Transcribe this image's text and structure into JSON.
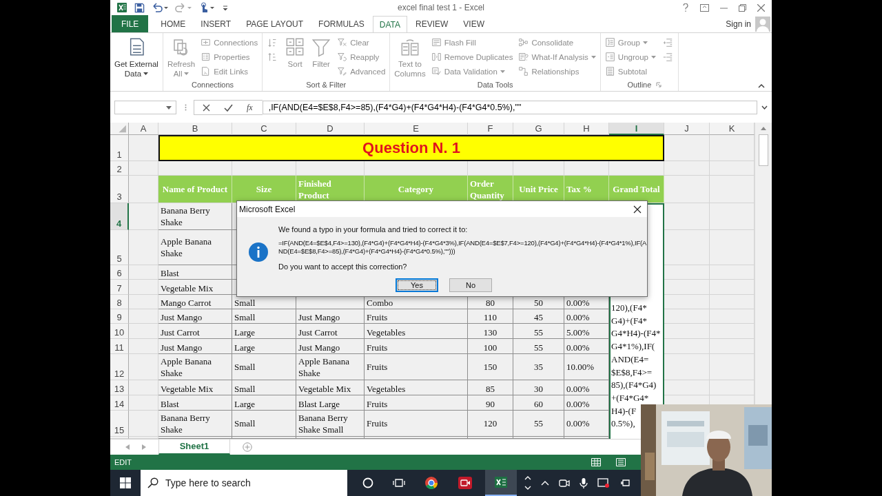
{
  "window": {
    "title": "excel final test 1 - Excel"
  },
  "ribbon_tabs": [
    {
      "label": "FILE",
      "kind": "file",
      "selected": false
    },
    {
      "label": "HOME",
      "kind": "tab",
      "selected": false
    },
    {
      "label": "INSERT",
      "kind": "tab",
      "selected": false
    },
    {
      "label": "PAGE LAYOUT",
      "kind": "tab",
      "selected": false
    },
    {
      "label": "FORMULAS",
      "kind": "tab",
      "selected": false
    },
    {
      "label": "DATA",
      "kind": "tab",
      "selected": true
    },
    {
      "label": "REVIEW",
      "kind": "tab",
      "selected": false
    },
    {
      "label": "VIEW",
      "kind": "tab",
      "selected": false
    }
  ],
  "account": {
    "label": "Sign in"
  },
  "ribbon_groups": [
    {
      "items": [
        {
          "lines": [
            "Get External",
            "Data"
          ],
          "kind": "large",
          "dropdown": true,
          "disabled": false
        }
      ]
    },
    {
      "label": "Connections",
      "items": [
        {
          "lines": [
            "Refresh",
            "All"
          ],
          "kind": "large",
          "dropdown": true,
          "disabled": true
        },
        {
          "lines": [
            "Connections"
          ],
          "kind": "small",
          "disabled": true
        },
        {
          "lines": [
            "Properties"
          ],
          "kind": "small",
          "disabled": true
        },
        {
          "lines": [
            "Edit Links"
          ],
          "kind": "small",
          "disabled": true
        }
      ]
    },
    {
      "label": "Sort & Filter",
      "items": [
        {
          "kind": "small",
          "disabled": true
        },
        {
          "kind": "small",
          "disabled": true
        },
        {
          "lines": [
            "Sort"
          ],
          "kind": "large",
          "disabled": true
        },
        {
          "lines": [
            "Filter"
          ],
          "kind": "large",
          "disabled": true
        },
        {
          "lines": [
            "Clear"
          ],
          "kind": "small",
          "disabled": true
        },
        {
          "lines": [
            "Reapply"
          ],
          "kind": "small",
          "disabled": true
        },
        {
          "lines": [
            "Advanced"
          ],
          "kind": "small",
          "disabled": true
        }
      ]
    },
    {
      "label": "Data Tools",
      "items": [
        {
          "lines": [
            "Text to",
            "Columns"
          ],
          "kind": "large",
          "disabled": true
        },
        {
          "lines": [
            "Flash Fill"
          ],
          "kind": "small",
          "disabled": true
        },
        {
          "lines": [
            "Remove Duplicates"
          ],
          "kind": "small",
          "disabled": true
        },
        {
          "lines": [
            "Data Validation"
          ],
          "kind": "small",
          "dropdown": true,
          "disabled": true
        },
        {
          "lines": [
            "Consolidate"
          ],
          "kind": "small",
          "disabled": true
        },
        {
          "lines": [
            "What-If Analysis"
          ],
          "kind": "small",
          "dropdown": true,
          "disabled": true
        },
        {
          "lines": [
            "Relationships"
          ],
          "kind": "small",
          "disabled": true
        }
      ]
    },
    {
      "label": "Outline",
      "items": [
        {
          "lines": [
            "Group"
          ],
          "kind": "small",
          "dropdown": true,
          "disabled": true
        },
        {
          "lines": [
            "Ungroup"
          ],
          "kind": "small",
          "dropdown": true,
          "disabled": true
        },
        {
          "lines": [
            "Subtotal"
          ],
          "kind": "small",
          "disabled": true
        },
        {
          "kind": "small",
          "disabled": true
        },
        {
          "kind": "small",
          "disabled": true
        }
      ]
    }
  ],
  "formula_bar": {
    "function_label": "fx",
    "value": ",IF(AND(E4=$E$8,F4>=85),(F4*G4)+(F4*G4*H4)-(F4*G4*0.5%),\"\""
  },
  "columns": [
    {
      "label": "A",
      "selected": false
    },
    {
      "label": "B",
      "selected": false
    },
    {
      "label": "C",
      "selected": false
    },
    {
      "label": "D",
      "selected": false
    },
    {
      "label": "E",
      "selected": false
    },
    {
      "label": "F",
      "selected": false
    },
    {
      "label": "G",
      "selected": false
    },
    {
      "label": "H",
      "selected": false
    },
    {
      "label": "I",
      "selected": true
    },
    {
      "label": "J",
      "selected": false
    },
    {
      "label": "K",
      "selected": false
    }
  ],
  "rows": [
    {
      "number": "1",
      "selected": false,
      "kind": "title",
      "text": "Question N. 1"
    },
    {
      "number": "2",
      "selected": false,
      "kind": "blank"
    },
    {
      "number": "3",
      "selected": false,
      "kind": "header",
      "cells": {
        "B": "Name of Product",
        "C": "Size",
        "D": "Finished Product",
        "E": "Category",
        "F": "Order Quantity",
        "G": "Unit Price",
        "H": "Tax %",
        "I": "Grand Total"
      }
    },
    {
      "number": "4",
      "selected": true,
      "kind": "data",
      "cells": {
        "B": "Banana Berry Shake"
      }
    },
    {
      "number": "5",
      "selected": false,
      "kind": "data",
      "cells": {
        "B": "Apple Banana Shake"
      }
    },
    {
      "number": "6",
      "selected": false,
      "kind": "data",
      "cells": {
        "B": "Blast"
      }
    },
    {
      "number": "7",
      "selected": false,
      "kind": "data",
      "cells": {
        "B": "Vegetable Mix"
      }
    },
    {
      "number": "8",
      "selected": false,
      "kind": "data",
      "cells": {
        "B": "Mango Carrot",
        "C": "Small",
        "E": "Combo",
        "F": "80",
        "G": "50",
        "H": "0.00%"
      }
    },
    {
      "number": "9",
      "selected": false,
      "kind": "data",
      "cells": {
        "B": "Just Mango",
        "C": "Small",
        "D": "Just Mango",
        "E": "Fruits",
        "F": "110",
        "G": "45",
        "H": "0.00%"
      }
    },
    {
      "number": "10",
      "selected": false,
      "kind": "data",
      "cells": {
        "B": "Just Carrot",
        "C": "Large",
        "D": "Just Carrot",
        "E": "Vegetables",
        "F": "130",
        "G": "55",
        "H": "5.00%"
      }
    },
    {
      "number": "11",
      "selected": false,
      "kind": "data",
      "cells": {
        "B": "Just Mango",
        "C": "Large",
        "D": "Just Mango",
        "E": "Fruits",
        "F": "100",
        "G": "55",
        "H": "0.00%"
      }
    },
    {
      "number": "12",
      "selected": false,
      "kind": "data",
      "cells": {
        "B": "Apple Banana Shake",
        "C": "Small",
        "D": "Apple Banana Shake",
        "E": "Fruits",
        "F": "150",
        "G": "35",
        "H": "10.00%"
      }
    },
    {
      "number": "13",
      "selected": false,
      "kind": "data",
      "cells": {
        "B": "Vegetable Mix",
        "C": "Small",
        "D": "Vegetable Mix",
        "E": "Vegetables",
        "F": "85",
        "G": "30",
        "H": "0.00%"
      }
    },
    {
      "number": "14",
      "selected": false,
      "kind": "data",
      "cells": {
        "B": "Blast",
        "C": "Large",
        "D": "Blast Large",
        "E": "Fruits",
        "F": "90",
        "G": "60",
        "H": "0.00%"
      }
    },
    {
      "number": "15",
      "selected": false,
      "kind": "data",
      "cells": {
        "B": "Banana Berry Shake",
        "C": "Small",
        "D": "Banana Berry Shake Small",
        "E": "Fruits",
        "F": "120",
        "G": "55",
        "H": "0.00%"
      }
    }
  ],
  "cell_editor": {
    "lines": [
      "120),(F4*",
      "G4)+(F4*",
      "G4*H4)-(F4*",
      "G4*1%),IF(",
      "AND(E4=",
      "$E$8,F4>=",
      "85),(F4*G4)",
      "+(F4*G4*",
      "H4)-(F",
      "0.5%),"
    ]
  },
  "sheet_tabs": [
    {
      "label": "Sheet1",
      "selected": true
    }
  ],
  "status_bar": {
    "mode": "EDIT"
  },
  "dialog": {
    "title": "Microsoft Excel",
    "message": "We found a typo in your formula and tried to correct it to:",
    "formula": "=IF(AND(E4=$E$4,F4>=130),(F4*G4)+(F4*G4*H4)-(F4*G4*3%),IF(AND(E4=$E$7,F4>=120),(F4*G4)+(F4*G4*H4)-(F4*G4*1%),IF(AND(E4=$E$8,F4>=85),(F4*G4)+(F4*G4*H4)-(F4*G4*0.5%),\"\")))",
    "question": "Do you want to accept this correction?",
    "buttons": [
      {
        "label": "Yes",
        "selected": true
      },
      {
        "label": "No",
        "selected": false
      }
    ]
  },
  "taskbar": {
    "search_placeholder": "Type here to search"
  }
}
